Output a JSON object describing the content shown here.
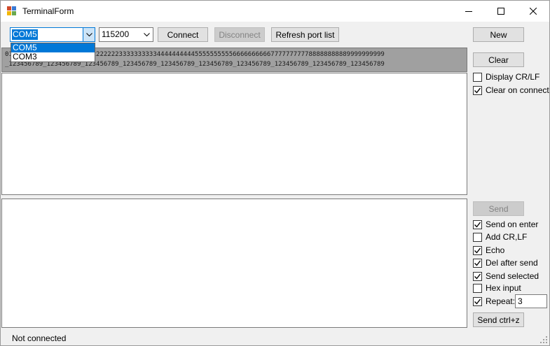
{
  "window": {
    "title": "TerminalForm",
    "icon": "app-window-icon"
  },
  "title_controls": {
    "minimize_icon": "minimize-icon",
    "maximize_icon": "maximize-icon",
    "close_icon": "close-icon"
  },
  "toolbar": {
    "port_combo_value": "COM5",
    "baud_combo_value": "115200",
    "connect_label": "Connect",
    "disconnect_label": "Disconnect",
    "refresh_label": "Refresh port list"
  },
  "port_dropdown": {
    "options": [
      "COM5",
      "COM3"
    ],
    "selected": "COM5"
  },
  "receive_log": {
    "line1": "0123456789111111111122222222223333333333444444444455555555556666666666777777777788888888889999999999",
    "line2": "_123456789_123456789_123456789_123456789_123456789_123456789_123456789_123456789_123456789_123456789"
  },
  "right_panel": {
    "new_label": "New",
    "clear_label": "Clear",
    "display_crlf_label": "Display CR/LF",
    "display_crlf_checked": false,
    "clear_on_connect_label": "Clear on connect",
    "clear_on_connect_checked": true,
    "send_label": "Send",
    "send_on_enter_label": "Send on enter",
    "send_on_enter_checked": true,
    "add_crlf_label": "Add CR,LF",
    "add_crlf_checked": false,
    "echo_label": "Echo",
    "echo_checked": true,
    "del_after_send_label": "Del after send",
    "del_after_send_checked": true,
    "send_selected_label": "Send selected",
    "send_selected_checked": true,
    "hex_input_label": "Hex input",
    "hex_input_checked": false,
    "repeat_label": "Repeat:",
    "repeat_checked": true,
    "repeat_value": "3",
    "send_ctrlz_label": "Send ctrl+z"
  },
  "status_bar": {
    "text": "Not connected"
  },
  "colors": {
    "accent": "#0078d7",
    "button_face": "#e1e1e1",
    "window_bg": "#f0f0f0",
    "log_bg": "#a0a0a0"
  }
}
